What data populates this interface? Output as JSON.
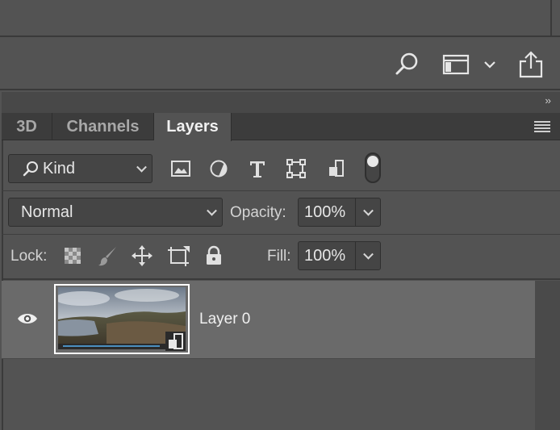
{
  "toolbar": {
    "icons": [
      "search-icon",
      "workspace-icon",
      "chevron-down-icon",
      "share-icon"
    ]
  },
  "panel": {
    "collapse_label": "››",
    "tabs": [
      {
        "label": "3D",
        "active": false
      },
      {
        "label": "Channels",
        "active": false
      },
      {
        "label": "Layers",
        "active": true
      }
    ],
    "filter": {
      "kind_label": "Kind",
      "filter_icons": [
        "image-filter-icon",
        "adjustment-filter-icon",
        "type-filter-icon",
        "shape-filter-icon",
        "smart-object-filter-icon"
      ]
    },
    "blend_mode": "Normal",
    "opacity_label": "Opacity:",
    "opacity_value": "100%",
    "lock_label": "Lock:",
    "lock_icons": [
      "lock-transparent-pixels-icon",
      "lock-image-pixels-icon",
      "lock-position-icon",
      "lock-artboard-icon",
      "lock-all-icon"
    ],
    "fill_label": "Fill:",
    "fill_value": "100%",
    "layers": [
      {
        "name": "Layer 0",
        "visible": true,
        "selected": true,
        "smart_object": true
      }
    ]
  },
  "colors": {
    "panel_bg": "#535353",
    "tab_bar_bg": "#3c3c3c",
    "selected_layer_bg": "#6a6a6a",
    "field_bg": "#454545"
  }
}
